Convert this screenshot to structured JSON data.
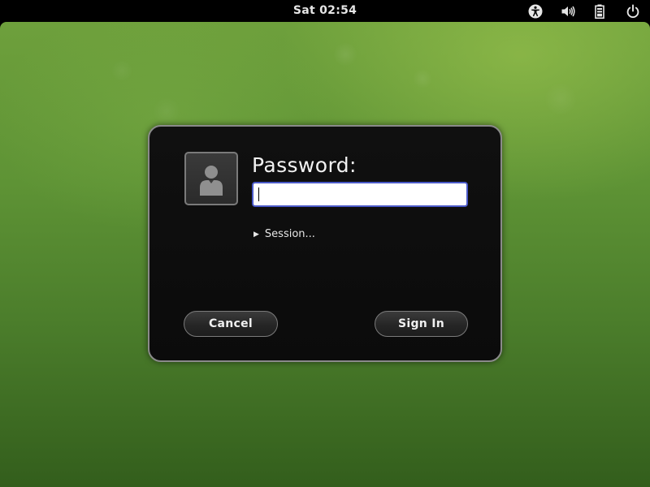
{
  "top_panel": {
    "clock": "Sat 02:54",
    "icons": [
      "accessibility-icon",
      "volume-icon",
      "battery-icon",
      "power-icon"
    ]
  },
  "login": {
    "password_label": "Password:",
    "password_value": "",
    "session_label": "Session...",
    "cancel_label": "Cancel",
    "sign_in_label": "Sign In"
  },
  "colors": {
    "panel_bg": "#000000",
    "desktop_green": "#5e9335",
    "dialog_bg": "#0d0d0d",
    "dialog_border": "#8a8a8a",
    "focus_border": "#4a59c8"
  }
}
